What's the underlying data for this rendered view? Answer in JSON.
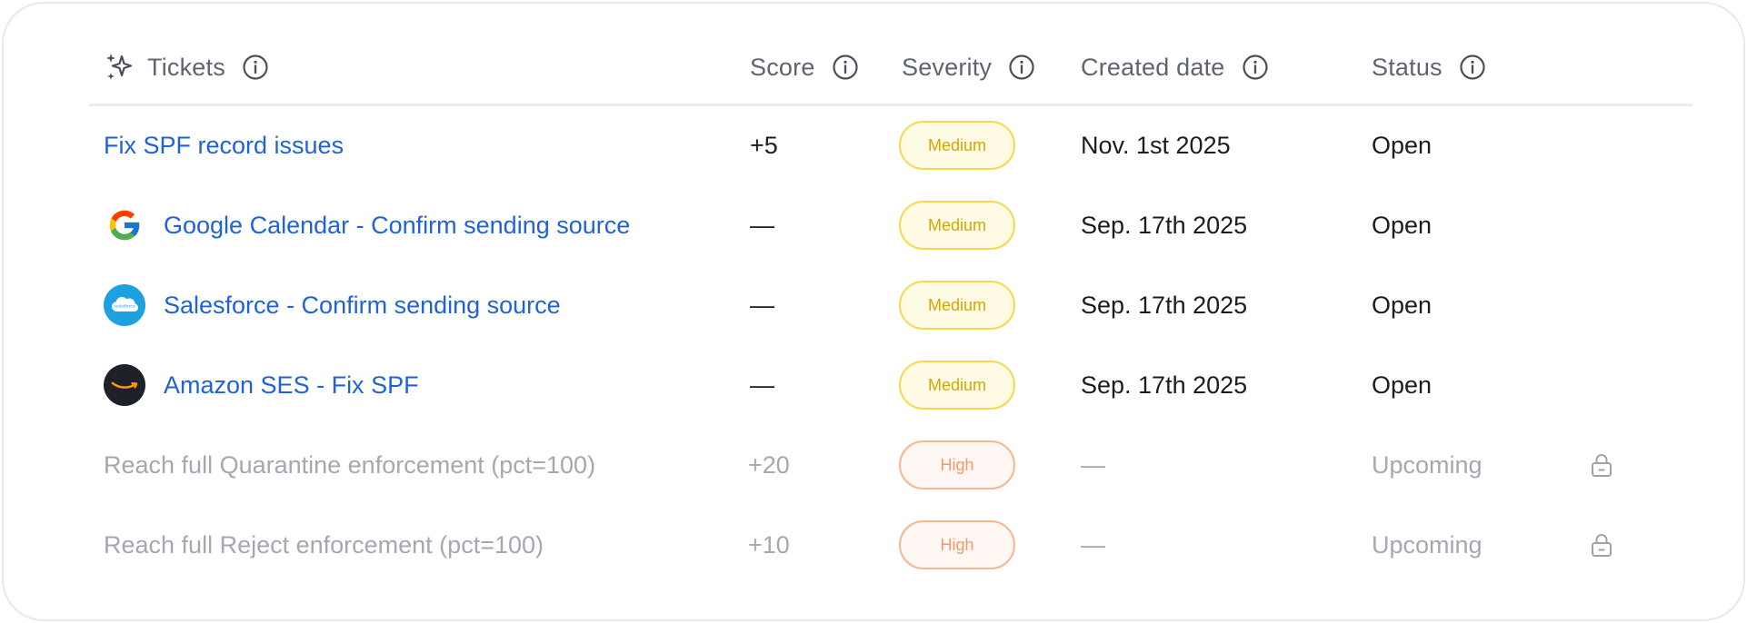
{
  "header": {
    "tickets": "Tickets",
    "score": "Score",
    "severity": "Severity",
    "created": "Created date",
    "status": "Status"
  },
  "rows": [
    {
      "title": "Fix SPF record issues",
      "logo": "",
      "score": "+5",
      "severity": "Medium",
      "created": "Nov. 1st 2025",
      "status": "Open",
      "locked": false
    },
    {
      "title": "Google Calendar - Confirm sending source",
      "logo": "google-icon",
      "score": "—",
      "severity": "Medium",
      "created": "Sep. 17th 2025",
      "status": "Open",
      "locked": false
    },
    {
      "title": "Salesforce - Confirm sending source",
      "logo": "salesforce-icon",
      "score": "—",
      "severity": "Medium",
      "created": "Sep. 17th 2025",
      "status": "Open",
      "locked": false
    },
    {
      "title": "Amazon SES - Fix SPF",
      "logo": "amazon-icon",
      "score": "—",
      "severity": "Medium",
      "created": "Sep. 17th 2025",
      "status": "Open",
      "locked": false
    },
    {
      "title": "Reach full Quarantine enforcement (pct=100)",
      "logo": "",
      "score": "+20",
      "severity": "High",
      "created": "—",
      "status": "Upcoming",
      "locked": true
    },
    {
      "title": "Reach full Reject enforcement (pct=100)",
      "logo": "",
      "score": "+10",
      "severity": "High",
      "created": "—",
      "status": "Upcoming",
      "locked": true
    }
  ],
  "colors": {
    "link": "#1f63d6",
    "muted": "#a4a8b0",
    "medium_badge": "#f8d84e",
    "high_badge": "#f8b58d"
  },
  "icons": [
    "sparkle-icon",
    "info-icon",
    "google-icon",
    "salesforce-icon",
    "amazon-icon",
    "lock-icon"
  ]
}
